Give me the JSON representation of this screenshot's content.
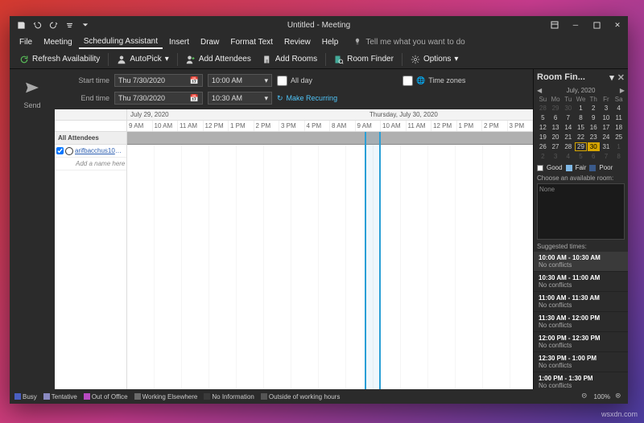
{
  "titlebar": {
    "title": "Untitled - Meeting",
    "qat": [
      "save-icon",
      "undo-icon",
      "redo-icon",
      "sync-icon",
      "down-icon"
    ]
  },
  "menubar": {
    "items": [
      "File",
      "Meeting",
      "Scheduling Assistant",
      "Insert",
      "Draw",
      "Format Text",
      "Review",
      "Help"
    ],
    "active_index": 2,
    "tell_me": "Tell me what you want to do"
  },
  "ribbon": {
    "refresh": "Refresh Availability",
    "autopick": "AutoPick",
    "add_attendees": "Add Attendees",
    "add_rooms": "Add Rooms",
    "room_finder": "Room Finder",
    "options": "Options"
  },
  "send_label": "Send",
  "time_block": {
    "start_label": "Start time",
    "end_label": "End time",
    "start_date": "Thu 7/30/2020",
    "end_date": "Thu 7/30/2020",
    "start_time": "10:00 AM",
    "end_time": "10:30 AM",
    "all_day_label": "All day",
    "time_zones_label": "Time zones",
    "make_recurring": "Make Recurring"
  },
  "schedule_grid": {
    "day1_label": "July 29, 2020",
    "day2_label": "Thursday, July 30, 2020",
    "hours": [
      "9 AM",
      "10 AM",
      "11 AM",
      "12 PM",
      "1 PM",
      "2 PM",
      "3 PM",
      "4 PM",
      "8 AM",
      "9 AM",
      "10 AM",
      "11 AM",
      "12 PM",
      "1 PM",
      "2 PM",
      "3 PM"
    ],
    "all_attendees_label": "All Attendees",
    "attendees": [
      {
        "name": "arifbacchus10@live.",
        "is_organizer": true
      }
    ],
    "add_name_placeholder": "Add a name here"
  },
  "room_finder": {
    "title": "Room Fin...",
    "month_label": "July, 2020",
    "dow": [
      "Su",
      "Mo",
      "Tu",
      "We",
      "Th",
      "Fr",
      "Sa"
    ],
    "weeks": [
      [
        28,
        29,
        30,
        1,
        2,
        3,
        4
      ],
      [
        5,
        6,
        7,
        8,
        9,
        10,
        11
      ],
      [
        12,
        13,
        14,
        15,
        16,
        17,
        18
      ],
      [
        19,
        20,
        21,
        22,
        23,
        24,
        25
      ],
      [
        26,
        27,
        28,
        29,
        30,
        31,
        1
      ],
      [
        2,
        3,
        4,
        5,
        6,
        7,
        8
      ]
    ],
    "selected_day": 30,
    "today": 29,
    "legend": {
      "good": "Good",
      "fair": "Fair",
      "poor": "Poor",
      "good_color": "#ffffff",
      "fair_color": "#7fb8e6",
      "poor_color": "#3a5a8a"
    },
    "choose_room_label": "Choose an available room:",
    "room_none": "None",
    "suggested_label": "Suggested times:",
    "suggestions": [
      {
        "time": "10:00 AM - 10:30 AM",
        "sub": "No conflicts",
        "selected": true
      },
      {
        "time": "10:30 AM - 11:00 AM",
        "sub": "No conflicts"
      },
      {
        "time": "11:00 AM - 11:30 AM",
        "sub": "No conflicts"
      },
      {
        "time": "11:30 AM - 12:00 PM",
        "sub": "No conflicts"
      },
      {
        "time": "12:00 PM - 12:30 PM",
        "sub": "No conflicts"
      },
      {
        "time": "12:30 PM - 1:00 PM",
        "sub": "No conflicts"
      },
      {
        "time": "1:00 PM - 1:30 PM",
        "sub": "No conflicts"
      }
    ]
  },
  "statusbar": {
    "legend": [
      {
        "label": "Busy",
        "color": "#4a5fc1"
      },
      {
        "label": "Tentative",
        "color": "#8a8ac1"
      },
      {
        "label": "Out of Office",
        "color": "#b84ac1"
      },
      {
        "label": "Working Elsewhere",
        "color": "#6a6a6a"
      },
      {
        "label": "No Information",
        "color": "#3a3a3a"
      },
      {
        "label": "Outside of working hours",
        "color": "#555555"
      }
    ],
    "zoom": "100%"
  },
  "watermark": "wsxdn.com"
}
